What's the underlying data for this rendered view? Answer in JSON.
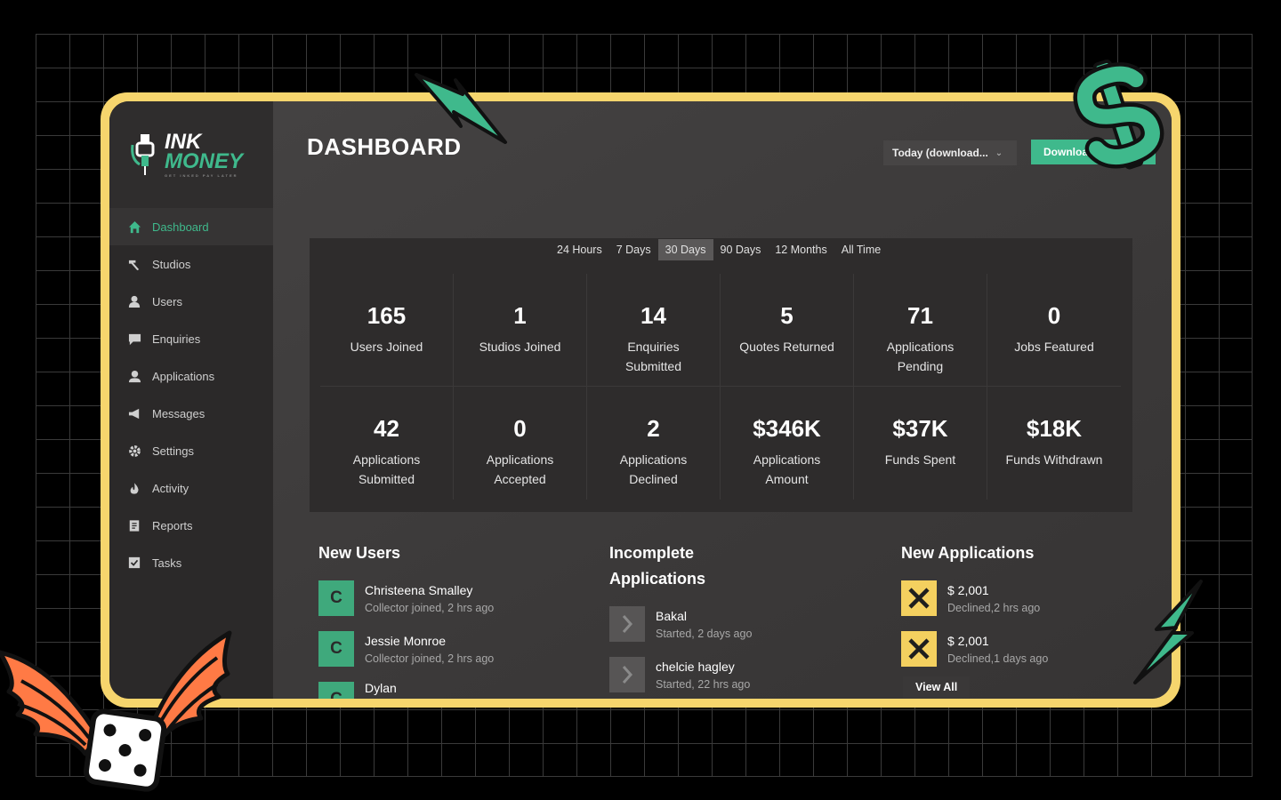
{
  "brand": {
    "line1": "INK",
    "line2": "MONEY",
    "tagline": "GET INKED PAY LATER"
  },
  "sidebar": {
    "items": [
      {
        "label": "Dashboard",
        "icon": "home-icon",
        "active": true
      },
      {
        "label": "Studios",
        "icon": "tattoo-machine-icon"
      },
      {
        "label": "Users",
        "icon": "user-icon"
      },
      {
        "label": "Enquiries",
        "icon": "chat-icon"
      },
      {
        "label": "Applications",
        "icon": "user-doc-icon"
      },
      {
        "label": "Messages",
        "icon": "megaphone-icon"
      },
      {
        "label": "Settings",
        "icon": "gear-icon"
      },
      {
        "label": "Activity",
        "icon": "flame-icon"
      },
      {
        "label": "Reports",
        "icon": "report-icon"
      },
      {
        "label": "Tasks",
        "icon": "checkbox-icon"
      }
    ]
  },
  "header": {
    "title": "DASHBOARD",
    "range_select": "Today (download...",
    "download_label": "Download"
  },
  "periods": {
    "tabs": [
      "24 Hours",
      "7 Days",
      "30 Days",
      "90 Days",
      "12 Months",
      "All Time"
    ],
    "active": "30 Days"
  },
  "stats": [
    {
      "value": "165",
      "label": "Users Joined"
    },
    {
      "value": "1",
      "label": "Studios Joined"
    },
    {
      "value": "14",
      "label": "Enquiries Submitted"
    },
    {
      "value": "5",
      "label": "Quotes Returned"
    },
    {
      "value": "71",
      "label": "Applications Pending"
    },
    {
      "value": "0",
      "label": "Jobs Featured"
    },
    {
      "value": "42",
      "label": "Applications Submitted"
    },
    {
      "value": "0",
      "label": "Applications Accepted"
    },
    {
      "value": "2",
      "label": "Applications Declined"
    },
    {
      "value": "$346K",
      "label": "Applications Amount"
    },
    {
      "value": "$37K",
      "label": "Funds Spent"
    },
    {
      "value": "$18K",
      "label": "Funds Withdrawn"
    }
  ],
  "new_users": {
    "title": "New Users",
    "items": [
      {
        "initial": "C",
        "name": "Christeena Smalley",
        "sub": "Collector joined, 2 hrs ago"
      },
      {
        "initial": "C",
        "name": "Jessie Monroe",
        "sub": "Collector joined, 2 hrs ago"
      },
      {
        "initial": "C",
        "name": "Dylan",
        "sub": ""
      }
    ]
  },
  "incomplete": {
    "title_line1": "Incomplete",
    "title_line2": "Applications",
    "items": [
      {
        "name": "Bakal",
        "sub": "Started, 2 days ago"
      },
      {
        "name": "chelcie hagley",
        "sub": "Started, 22 hrs ago"
      }
    ]
  },
  "new_applications": {
    "title": "New Applications",
    "items": [
      {
        "amount": "$ 2,001",
        "sub": "Declined,2 hrs ago"
      },
      {
        "amount": "$ 2,001",
        "sub": "Declined,1 days ago"
      }
    ],
    "view_all": "View All"
  },
  "colors": {
    "accent": "#3fb98c",
    "frame": "#f6d56d",
    "declined": "#f4d05f",
    "wings": "#ff7a45"
  }
}
